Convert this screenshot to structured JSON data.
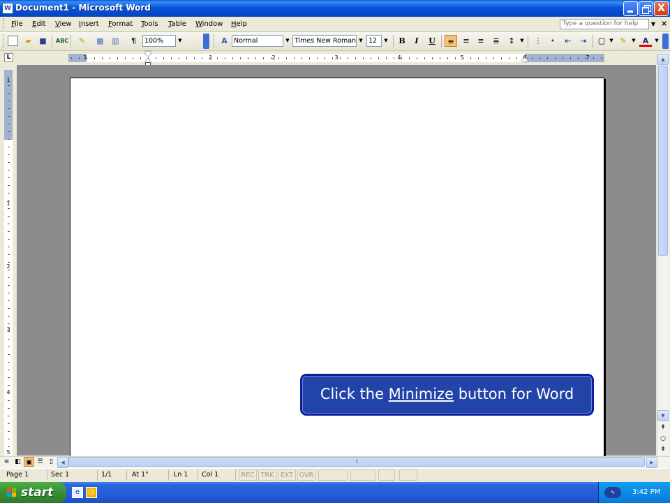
{
  "window": {
    "title": "Document1 - Microsoft Word",
    "close_glyph": "X"
  },
  "menubar": {
    "items": [
      "File",
      "Edit",
      "View",
      "Insert",
      "Format",
      "Tools",
      "Table",
      "Window",
      "Help"
    ],
    "help_placeholder": "Type a question for help",
    "doc_close_glyph": "×"
  },
  "toolbar": {
    "zoom": "100%",
    "style": "Normal",
    "font": "Times New Roman",
    "font_size": "12",
    "bold": "B",
    "italic": "I",
    "underline": "U",
    "pilcrow": "¶"
  },
  "ruler": {
    "horizontal_numbers": [
      "1",
      "1",
      "2",
      "3",
      "4",
      "5",
      "6",
      "7"
    ],
    "vertical_numbers": [
      "1",
      "1",
      "2",
      "3",
      "4",
      "5"
    ]
  },
  "statusbar": {
    "page": "Page 1",
    "section": "Sec 1",
    "page_of": "1/1",
    "at": "At 1\"",
    "line": "Ln 1",
    "col": "Col 1",
    "rec": "REC",
    "trk": "TRK",
    "ext": "EXT",
    "ovr": "OVR"
  },
  "taskbar": {
    "start_label": "start",
    "clock": "3:42 PM"
  },
  "callout": {
    "prefix": "Click the ",
    "link": "Minimize",
    "suffix": " button for Word"
  },
  "colors": {
    "titlebar": "#0855DD",
    "callout_bg": "#2244A8",
    "callout_border": "#0E1E9E",
    "workspace": "#8C8C8C",
    "taskbar": "#245DDB",
    "start_button": "#3A8E35"
  }
}
